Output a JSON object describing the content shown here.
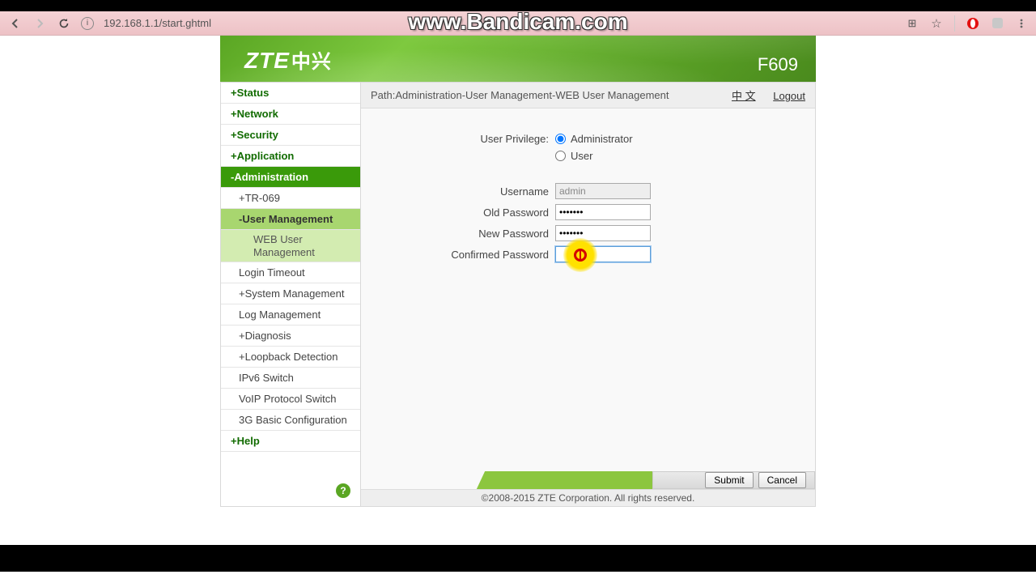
{
  "browser": {
    "url": "192.168.1.1/start.ghtml",
    "watermark": "www.Bandicam.com"
  },
  "banner": {
    "logo_en": "ZTE",
    "logo_cn": "中兴",
    "model": "F609"
  },
  "sidebar": {
    "status": "+Status",
    "network": "+Network",
    "security": "+Security",
    "application": "+Application",
    "administration": "-Administration",
    "admin_sub": {
      "tr069": "+TR-069",
      "usermgmt": "-User Management",
      "webuser": "WEB User Management",
      "logintimeout": "Login Timeout",
      "sysmgmt": "+System Management",
      "logmgmt": "Log Management",
      "diagnosis": "+Diagnosis",
      "loopback": "+Loopback Detection",
      "ipv6": "IPv6 Switch",
      "voip": "VoIP Protocol Switch",
      "g3": "3G Basic Configuration"
    },
    "help": "+Help"
  },
  "path": {
    "label": "Path:Administration-User Management-WEB User Management",
    "lang": "中 文",
    "logout": "Logout"
  },
  "form": {
    "priv_label": "User Privilege:",
    "priv_admin": "Administrator",
    "priv_user": "User",
    "username_label": "Username",
    "username_value": "admin",
    "oldpw_label": "Old Password",
    "oldpw_value": "•••••••",
    "newpw_label": "New Password",
    "newpw_value": "•••••••",
    "confpw_label": "Confirmed Password",
    "confpw_value": ""
  },
  "footer": {
    "submit": "Submit",
    "cancel": "Cancel",
    "copyright": "©2008-2015 ZTE Corporation. All rights reserved."
  }
}
